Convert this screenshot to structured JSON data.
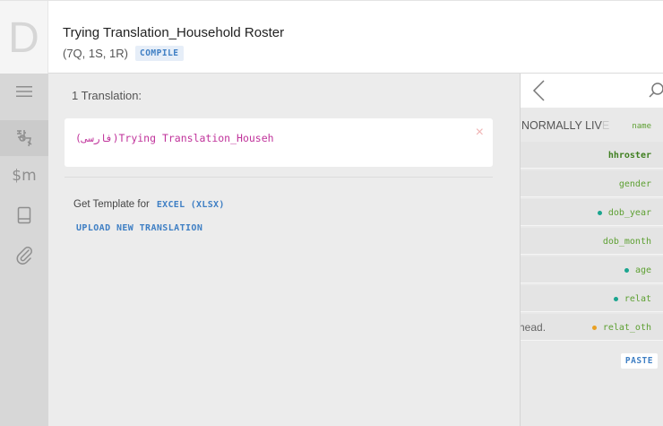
{
  "header": {
    "logo_letter": "D",
    "title": "Trying Translation_Household Roster",
    "subtitle": "(7Q, 1S, 1R)",
    "compile_label": "COMPILE"
  },
  "sidebar": {
    "items": [
      {
        "name": "menu-icon"
      },
      {
        "name": "translate-icon"
      },
      {
        "name": "macros-icon",
        "label": "$m"
      },
      {
        "name": "book-icon"
      },
      {
        "name": "attachment-icon"
      }
    ]
  },
  "main": {
    "heading": "1 Translation:",
    "translation_name": "(فارسی)Trying Translation_Househ",
    "close_symbol": "×",
    "template_label": "Get Template for",
    "template_link": "EXCEL (XLSX)",
    "upload_label": "UPLOAD NEW TRANSLATION"
  },
  "right_panel": {
    "header_left": "NORMALLY LIV",
    "header_left_fade": "E",
    "header_right": "name",
    "rows": [
      {
        "name": "hhroster",
        "bold": true,
        "dot": "",
        "left_text": ""
      },
      {
        "name": "gender",
        "bold": false,
        "dot": "",
        "left_text": ""
      },
      {
        "name": "dob_year",
        "bold": false,
        "dot": "teal",
        "left_text": ""
      },
      {
        "name": "dob_month",
        "bold": false,
        "dot": "",
        "left_text": ""
      },
      {
        "name": "age",
        "bold": false,
        "dot": "teal",
        "left_text": ""
      },
      {
        "name": "relat",
        "bold": false,
        "dot": "teal",
        "left_text": ""
      },
      {
        "name": "relat_oth",
        "bold": false,
        "dot": "orange",
        "left_text": "head."
      }
    ],
    "paste_label": "PASTE"
  },
  "colors": {
    "accent": "#3f7fc4",
    "translation_text": "#c0339b",
    "variable_green": "#5ea033",
    "dot_teal": "#1ba58f",
    "dot_orange": "#e9a023"
  }
}
